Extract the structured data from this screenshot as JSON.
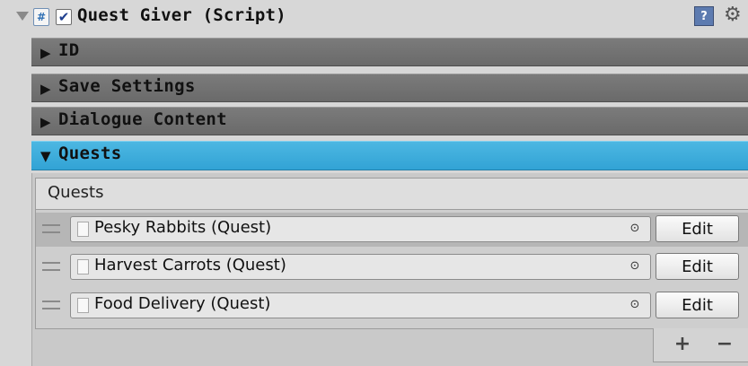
{
  "component": {
    "title": "Quest Giver (Script)",
    "enabled_check": "✔",
    "script_glyph": "#",
    "help_glyph": "?",
    "settings_glyph": "⚙",
    "fold_glyph": "▼"
  },
  "foldouts": [
    {
      "label": "ID",
      "arrow": "▶",
      "expanded": false
    },
    {
      "label": "Save Settings",
      "arrow": "▶",
      "expanded": false
    },
    {
      "label": "Dialogue Content",
      "arrow": "▶",
      "expanded": false
    },
    {
      "label": "Quests",
      "arrow": "▼",
      "expanded": true
    }
  ],
  "quest_list": {
    "header": "Quests",
    "items": [
      {
        "label": "Pesky Rabbits (Quest)",
        "button": "Edit"
      },
      {
        "label": "Harvest Carrots (Quest)",
        "button": "Edit"
      },
      {
        "label": "Food Delivery (Quest)",
        "button": "Edit"
      }
    ],
    "picker_glyph": "⊙",
    "add_glyph": "+",
    "remove_glyph": "−"
  },
  "colors": {
    "active_foldout": "#3aa9db",
    "foldout": "#727272",
    "panel": "#d7d7d7"
  }
}
